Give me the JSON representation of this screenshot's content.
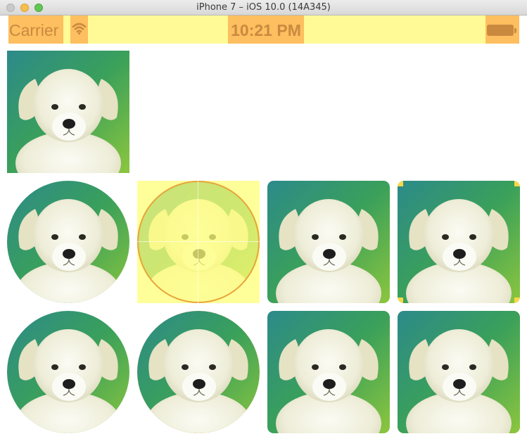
{
  "window": {
    "title": "iPhone 7 – iOS 10.0 (14A345)"
  },
  "status_bar": {
    "carrier": "Carrier",
    "time": "10:21 PM",
    "wifi_icon": "wifi-icon",
    "battery_icon": "battery-icon",
    "highlight_color": "#fffa96",
    "element_highlight_color": "#fdbf5f"
  },
  "images": {
    "subject": "puppy",
    "accent_border_color": "#f29a3f",
    "grid": [
      {
        "row": 1,
        "col": 1,
        "shape": "square",
        "border": "none"
      },
      {
        "row": 2,
        "col": 1,
        "shape": "circle",
        "border": "none"
      },
      {
        "row": 2,
        "col": 2,
        "shape": "circle",
        "border": "orange",
        "highlighted": true
      },
      {
        "row": 2,
        "col": 3,
        "shape": "rounded",
        "border": "none"
      },
      {
        "row": 2,
        "col": 4,
        "shape": "rounded",
        "border": "orange"
      },
      {
        "row": 3,
        "col": 1,
        "shape": "circle",
        "border": "none"
      },
      {
        "row": 3,
        "col": 2,
        "shape": "circle",
        "border": "orange"
      },
      {
        "row": 3,
        "col": 3,
        "shape": "rounded",
        "border": "none"
      },
      {
        "row": 3,
        "col": 4,
        "shape": "rounded",
        "border": "orange"
      }
    ]
  }
}
